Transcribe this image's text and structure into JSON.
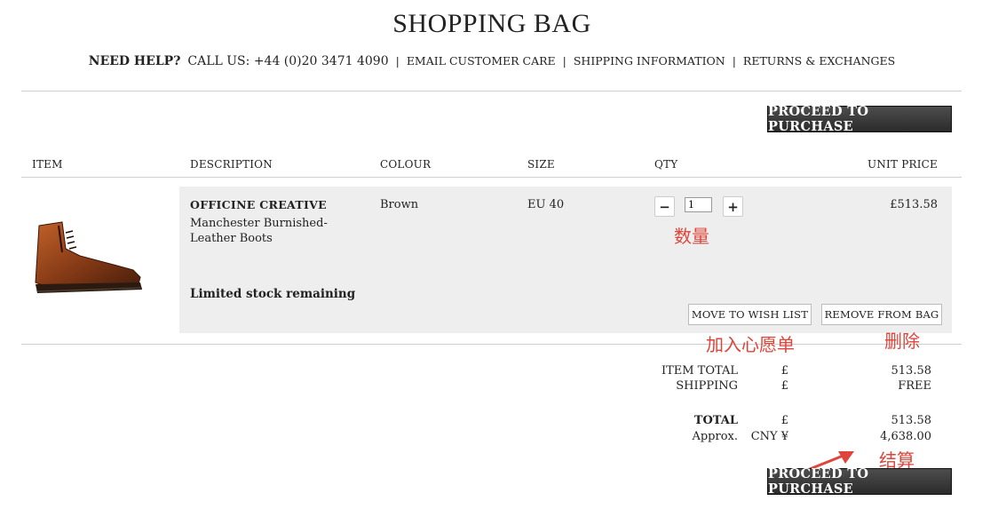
{
  "page": {
    "title": "SHOPPING BAG"
  },
  "help": {
    "need_help": "NEED HELP?",
    "call_us": "CALL US: +44 (0)20 3471 4090",
    "links": [
      "EMAIL CUSTOMER CARE",
      "SHIPPING INFORMATION",
      "RETURNS & EXCHANGES"
    ],
    "separator": "|"
  },
  "actions": {
    "proceed_label": "PROCEED TO PURCHASE"
  },
  "table": {
    "headers": [
      "ITEM",
      "DESCRIPTION",
      "COLOUR",
      "SIZE",
      "QTY",
      "UNIT PRICE"
    ]
  },
  "item": {
    "brand": "OFFICINE CREATIVE",
    "name": "Manchester Burnished-Leather Boots",
    "colour": "Brown",
    "size": "EU 40",
    "qty": "1",
    "unit_price": "£513.58",
    "stock_note": "Limited stock remaining",
    "move_to_wishlist": "MOVE TO WISH LIST",
    "remove_from_bag": "REMOVE FROM BAG",
    "qty_minus": "−",
    "qty_plus": "+"
  },
  "annotations": {
    "quantity": "数量",
    "wishlist": "加入心愿单",
    "delete": "删除",
    "checkout": "结算"
  },
  "summary": {
    "item_total_label": "ITEM TOTAL",
    "item_total_currency": "£",
    "item_total_value": "513.58",
    "shipping_label": "SHIPPING",
    "shipping_currency": "£",
    "shipping_value": "FREE",
    "total_label": "TOTAL",
    "total_currency": "£",
    "total_value": "513.58",
    "approx_label": "Approx.",
    "approx_currency": "CNY ¥",
    "approx_value": "4,638.00"
  },
  "colors": {
    "annotation": "#e0443a",
    "button_dark": "#333333",
    "panel": "#eeeeee"
  }
}
